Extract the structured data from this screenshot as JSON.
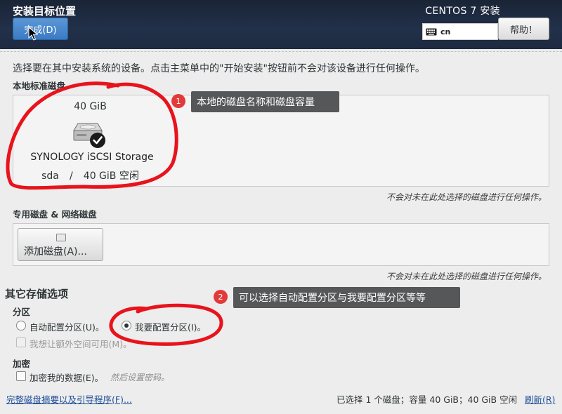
{
  "header": {
    "title": "安装目标位置",
    "done_label": "完成(D)",
    "product": "CENTOS 7 安装",
    "keyboard_layout": "cn",
    "help_label": "帮助！"
  },
  "intro": "选择要在其中安装系统的设备。点击主菜单中的\"开始安装\"按钮前不会对该设备进行任何操作。",
  "local_disks": {
    "label": "本地标准磁盘",
    "disk": {
      "size": "40 GiB",
      "name": "SYNOLOGY iSCSI Storage",
      "device": "sda",
      "separator": "/",
      "free": "40 GiB 空闲",
      "selected": true
    },
    "note": "不会对未在此处选择的磁盘进行任何操作。"
  },
  "special_disks": {
    "label": "专用磁盘 & 网络磁盘",
    "add_label": "添加磁盘(A)...",
    "note": "不会对未在此处选择的磁盘进行任何操作。"
  },
  "other_storage": {
    "heading": "其它存储选项",
    "partition_label": "分区",
    "auto_partition": "自动配置分区(U)。",
    "manual_partition": "我要配置分区(I)。",
    "extra_space": "我想让额外空间可用(M)。",
    "encryption_label": "加密",
    "encrypt_data": "加密我的数据(E)。",
    "encrypt_hint": "然后设置密码。"
  },
  "footer": {
    "summary_link": "完整磁盘摘要以及引导程序(F)...",
    "summary": "已选择 1 个磁盘；容量 40 GiB；40 GiB 空闲",
    "refresh_link": "刷新(R)"
  },
  "annotations": [
    {
      "number": "1",
      "text": "本地的磁盘名称和磁盘容量"
    },
    {
      "number": "2",
      "text": "可以选择自动配置分区与我要配置分区等等"
    }
  ],
  "colors": {
    "header_bg": "#22304a",
    "done_button": "#3b7bc4",
    "annotation_badge": "#e23a3a",
    "annotation_ink": "#e8131c",
    "callout_bg": "#555759",
    "link": "#1f4e99"
  },
  "icons": [
    "keyboard-icon",
    "hard-disk-icon",
    "checkmark-icon",
    "add-disk-icon",
    "cursor-icon"
  ]
}
